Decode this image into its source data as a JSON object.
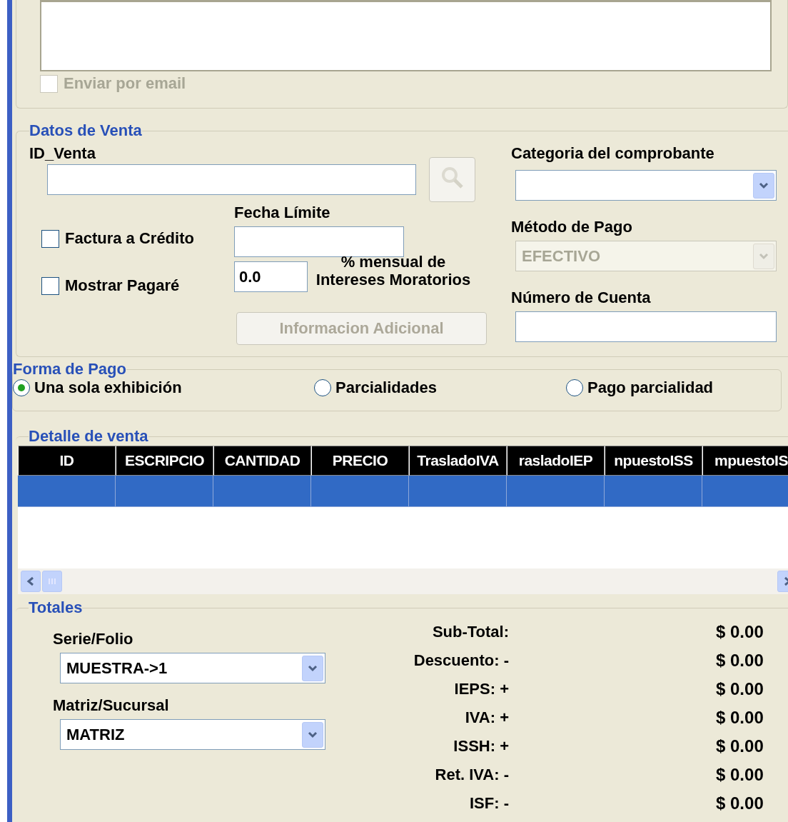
{
  "email_option": {
    "label": "Enviar por email",
    "checked": false,
    "disabled": true
  },
  "sale_data": {
    "legend": "Datos de Venta",
    "id_label": "ID_Venta",
    "search_disabled": true,
    "invoice_credit": {
      "label": "Factura a Crédito",
      "checked": false
    },
    "show_note": {
      "label": "Mostrar Pagaré",
      "checked": false
    },
    "due_date_label": "Fecha Límite",
    "interest_value": "0.0",
    "interest_label": "% mensual de Intereses Moratorios",
    "extra_button": {
      "label": "Informacion Adicional",
      "disabled": true
    },
    "category_label": "Categoria del comprobante",
    "payment_method": {
      "label": "Método de Pago",
      "value": "EFECTIVO",
      "disabled": true
    },
    "account_label": "Número de Cuenta"
  },
  "payment_form": {
    "legend": "Forma de Pago",
    "options": [
      {
        "label": "Una sola exhibición",
        "selected": true
      },
      {
        "label": "Parcialidades",
        "selected": false
      },
      {
        "label": "Pago parcialidad",
        "selected": false
      }
    ]
  },
  "detail": {
    "legend": "Detalle de venta",
    "columns": [
      "ID",
      "ESCRIPCIO",
      "CANTIDAD",
      "PRECIO",
      "TrasladoIVA",
      "rasladoIEP",
      "npuestoISS",
      "mpuestoIS"
    ],
    "rows": [
      {
        "selected": true
      }
    ]
  },
  "totals": {
    "legend": "Totales",
    "series": {
      "label": "Serie/Folio",
      "value": "MUESTRA->1"
    },
    "branch": {
      "label": "Matriz/Sucursal",
      "value": "MATRIZ"
    },
    "lines": [
      {
        "label": "Sub-Total:",
        "value": "$ 0.00"
      },
      {
        "label": "Descuento: -",
        "value": "$ 0.00"
      },
      {
        "label": "IEPS: +",
        "value": "$ 0.00"
      },
      {
        "label": "IVA: +",
        "value": "$ 0.00"
      },
      {
        "label": "ISSH: +",
        "value": "$ 0.00"
      },
      {
        "label": "Ret. IVA: -",
        "value": "$ 0.00"
      },
      {
        "label": "ISF: -",
        "value": "$ 0.00"
      }
    ]
  }
}
